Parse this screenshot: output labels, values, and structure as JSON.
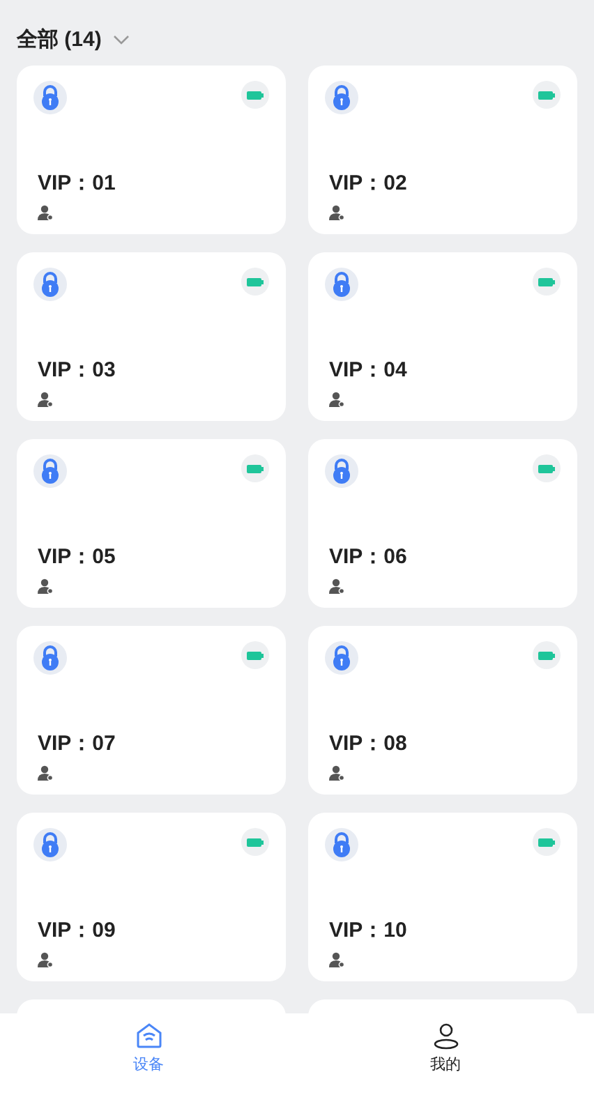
{
  "header": {
    "title": "全部 (14)"
  },
  "devices": [
    {
      "name": "VIP：01"
    },
    {
      "name": "VIP：02"
    },
    {
      "name": "VIP：03"
    },
    {
      "name": "VIP：04"
    },
    {
      "name": "VIP：05"
    },
    {
      "name": "VIP：06"
    },
    {
      "name": "VIP：07"
    },
    {
      "name": "VIP：08"
    },
    {
      "name": "VIP：09"
    },
    {
      "name": "VIP：10"
    }
  ],
  "tabs": [
    {
      "label": "设备",
      "kind": "home",
      "selected": true
    },
    {
      "label": "我的",
      "kind": "profile",
      "selected": false
    }
  ]
}
